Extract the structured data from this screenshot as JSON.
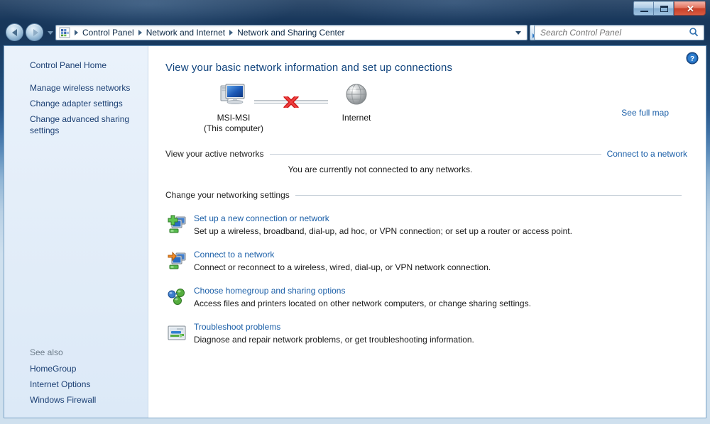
{
  "window": {
    "controls": {
      "minimize": "Minimize",
      "maximize": "Maximize",
      "close": "✕"
    }
  },
  "navigation": {
    "back": "Back",
    "forward": "Forward",
    "recent_pages": "Recent Pages",
    "breadcrumb": [
      "Control Panel",
      "Network and Internet",
      "Network and Sharing Center"
    ],
    "refresh": "Refresh",
    "history_dropdown": "Previous Locations"
  },
  "search": {
    "placeholder": "Search Control Panel",
    "value": ""
  },
  "sidebar": {
    "home": "Control Panel Home",
    "items": [
      {
        "label": "Manage wireless networks"
      },
      {
        "label": "Change adapter settings"
      },
      {
        "label": "Change advanced sharing settings"
      }
    ],
    "see_also_title": "See also",
    "see_also": [
      {
        "label": "HomeGroup"
      },
      {
        "label": "Internet Options"
      },
      {
        "label": "Windows Firewall"
      }
    ]
  },
  "content": {
    "help": "Help",
    "page_title": "View your basic network information and set up connections",
    "see_full_map": "See full map",
    "map": {
      "computer_name": "MSI-MSI",
      "computer_sub": "(This computer)",
      "internet_label": "Internet",
      "connection_status": "disconnected"
    },
    "active_networks": {
      "heading": "View your active networks",
      "action_link": "Connect to a network",
      "status": "You are currently not connected to any networks."
    },
    "networking_settings": {
      "heading": "Change your networking settings",
      "options": [
        {
          "title": "Set up a new connection or network",
          "desc": "Set up a wireless, broadband, dial-up, ad hoc, or VPN connection; or set up a router or access point."
        },
        {
          "title": "Connect to a network",
          "desc": "Connect or reconnect to a wireless, wired, dial-up, or VPN network connection."
        },
        {
          "title": "Choose homegroup and sharing options",
          "desc": "Access files and printers located on other network computers, or change sharing settings."
        },
        {
          "title": "Troubleshoot problems",
          "desc": "Diagnose and repair network problems, or get troubleshooting information."
        }
      ]
    }
  },
  "colors": {
    "link": "#1b5fa8",
    "title": "#12457e",
    "titlebar": "#17365a",
    "sidebar_bg": "#e4eef9",
    "error_x": "#d61f1f"
  }
}
